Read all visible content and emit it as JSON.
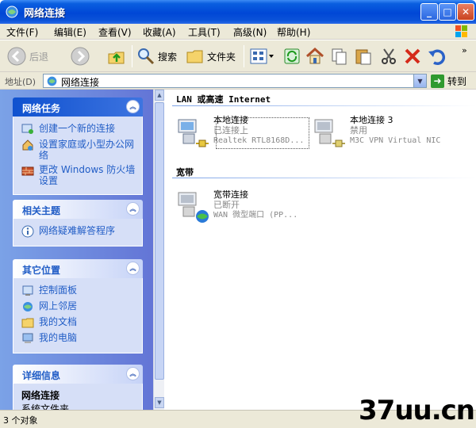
{
  "window": {
    "title": "网络连接"
  },
  "menu": [
    "文件(F)",
    "编辑(E)",
    "查看(V)",
    "收藏(A)",
    "工具(T)",
    "高级(N)",
    "帮助(H)"
  ],
  "toolbar": {
    "back": "后退",
    "search": "搜索",
    "folders": "文件夹"
  },
  "address": {
    "label": "地址(D)",
    "value": "网络连接",
    "go": "转到"
  },
  "left_panels": {
    "tasks": {
      "title": "网络任务",
      "items": [
        "创建一个新的连接",
        "设置家庭或小型办公网络",
        "更改 Windows 防火墙设置"
      ]
    },
    "related": {
      "title": "相关主题",
      "items": [
        "网络疑难解答程序"
      ]
    },
    "places": {
      "title": "其它位置",
      "items": [
        "控制面板",
        "网上邻居",
        "我的文档",
        "我的电脑"
      ]
    },
    "details": {
      "title": "详细信息",
      "name": "网络连接",
      "sub": "系统文件夹"
    }
  },
  "groups": [
    {
      "title": "LAN 或高速 Internet",
      "items": [
        {
          "name": "本地连接",
          "state": "已连接上",
          "device": "Realtek RTL8168D..."
        },
        {
          "name": "本地连接 3",
          "state": "禁用",
          "device": "M3C VPN Virtual NIC"
        }
      ]
    },
    {
      "title": "宽带",
      "items": [
        {
          "name": "宽带连接",
          "state": "已断开",
          "device": "WAN 微型端口 (PP..."
        }
      ]
    }
  ],
  "status": {
    "text": "3 个对象"
  },
  "watermark": {
    "text": "37uu.cn"
  },
  "colors": {
    "titlebar": "#0047d6",
    "panel_bg": "#d6dff7",
    "link": "#215dc6",
    "left_pane": "#7ba2e7"
  },
  "icons": [
    "network-folder-icon",
    "back-icon",
    "forward-icon",
    "up-folder-icon",
    "search-icon",
    "folders-icon",
    "views-icon",
    "sync-icon",
    "home-icon",
    "copy-icon",
    "paste-icon",
    "cut-icon",
    "delete-icon",
    "undo-icon",
    "go-arrow-icon",
    "lan-connection-icon",
    "broadband-connection-icon"
  ]
}
